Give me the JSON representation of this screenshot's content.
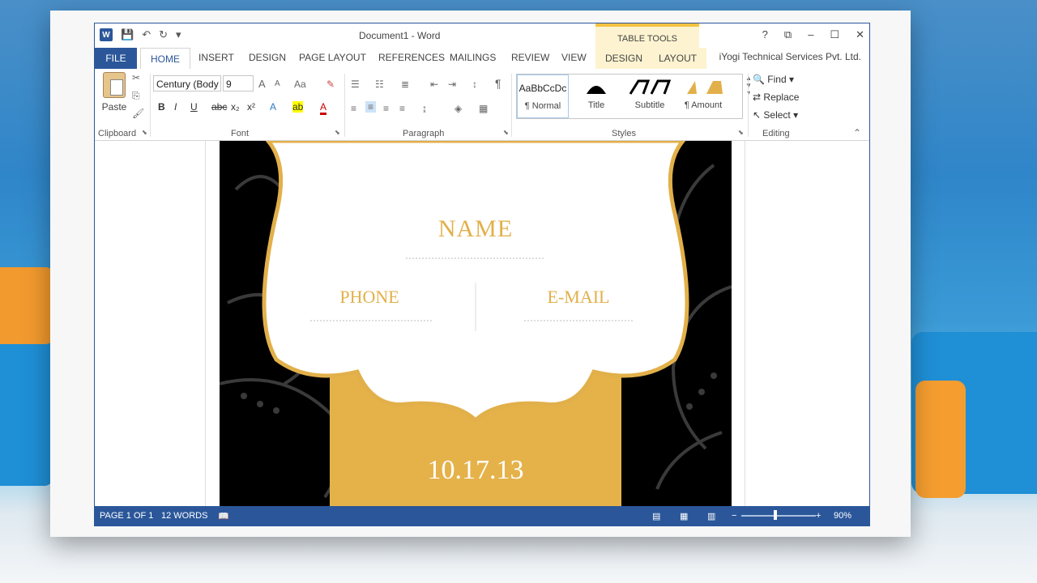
{
  "window": {
    "title": "Document1 - Word",
    "table_tools_label": "TABLE TOOLS",
    "user_name": "iYogi Technical Services Pvt. Ltd.",
    "controls": [
      "?",
      "⧉",
      "–",
      "☐",
      "✕"
    ]
  },
  "tabs": [
    {
      "label": "FILE"
    },
    {
      "label": "HOME"
    },
    {
      "label": "INSERT"
    },
    {
      "label": "DESIGN"
    },
    {
      "label": "PAGE LAYOUT"
    },
    {
      "label": "REFERENCES"
    },
    {
      "label": "MAILINGS"
    },
    {
      "label": "REVIEW"
    },
    {
      "label": "VIEW"
    },
    {
      "label": "DESIGN"
    },
    {
      "label": "LAYOUT"
    }
  ],
  "ribbon": {
    "clipboard": {
      "paste_label": "Paste",
      "group_label": "Clipboard"
    },
    "font": {
      "font_name": "Century (Body",
      "font_size": "9",
      "group_label": "Font",
      "bold": "B",
      "italic": "I",
      "underline": "U",
      "subscript": "x₂",
      "superscript": "x²",
      "case": "Aa",
      "grow": "A",
      "shrink": "A"
    },
    "paragraph": {
      "group_label": "Paragraph",
      "pilcrow": "¶"
    },
    "styles": {
      "group_label": "Styles",
      "items": [
        {
          "preview": "AaBbCcDc",
          "label": "¶ Normal"
        },
        {
          "preview": "",
          "label": "Title"
        },
        {
          "preview": "",
          "label": "Subtitle"
        },
        {
          "preview": "",
          "label": "¶ Amount"
        }
      ]
    },
    "editing": {
      "group_label": "Editing",
      "find": "Find",
      "replace": "Replace",
      "select": "Select"
    }
  },
  "document": {
    "name_placeholder": "NAME",
    "phone_placeholder": "PHONE",
    "email_placeholder": "E-MAIL",
    "date": "10.17.13"
  },
  "status": {
    "page": "PAGE 1 OF 1",
    "words": "12 WORDS",
    "zoom": "90%",
    "zoom_minus": "−",
    "zoom_plus": "+"
  },
  "colors": {
    "accent": "#2b579a",
    "gold": "#e2b04a",
    "page_bg": "#000000"
  }
}
